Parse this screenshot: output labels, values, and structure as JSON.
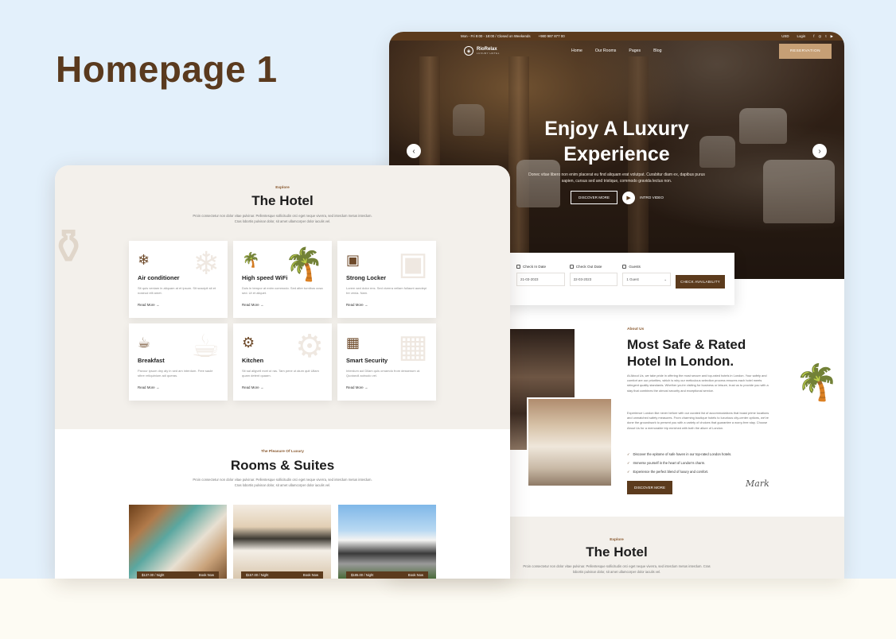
{
  "page": {
    "title": "Homepage 1"
  },
  "colors": {
    "brand": "#5c3b1d",
    "accent": "#c69f75",
    "background": "#e3f0fb"
  },
  "topbar": {
    "hours": "Mon - Fri 9:00 - 18:00 / Closed on Weekends",
    "phone": "+980 987 877 00",
    "currency": "USD",
    "login": "Login",
    "social_icons": [
      "facebook-icon",
      "instagram-icon",
      "twitter-icon",
      "youtube-icon"
    ]
  },
  "header": {
    "logo_name": "RioRelax",
    "logo_sub": "LUXURY HOTEL",
    "menu": [
      "Home",
      "Our Rooms",
      "Pages",
      "Blog"
    ],
    "reservation": "RESERVATION"
  },
  "hero": {
    "title_line1": "Enjoy A Luxury",
    "title_line2": "Experience",
    "text": "Donec vitae libero non enim placerat eu find aliquam erat volutpat. Curabitur diam ex, dapibus purus sapien, cursus sed and tristique, commodo gravida lectus non.",
    "discover": "DISCOVER MORE",
    "video": "INTRO VIDEO"
  },
  "booking": {
    "check_in_label": "Check In Date",
    "check_in_value": "21-03-2023",
    "check_out_label": "Check Out Date",
    "check_out_value": "22-03-2023",
    "guests_label": "Guests",
    "guests_value": "1 Guest",
    "button": "CHECK AVAILABILITY"
  },
  "about": {
    "tag": "About Us",
    "title": "Most Safe & Rated Hotel In London.",
    "para1": "At About Us, we take pride in offering the most secure and top-rated hotels in London. Your safety and comfort are our priorities, which is why our meticulous selection process ensures each hotel meets stringent quality standards. Whether you're visiting for business or leisure, trust us to provide you with a stay that combines the utmost security and exceptional service.",
    "para2": "Experience London like never before with our curated list of accommodations that boast prime locations and unmatched safety measures. From charming boutique hotels to luxurious city-center options, we've done the groundwork to present you with a variety of choices that guarantee a worry-free stay. Choose About Us for a memorable trip enriched with both the allure of London.",
    "checks": [
      "Discover the epitome of safe haven in our top-rated London hotels.",
      "Immerse yourself in the heart of London's charm.",
      "Experience the perfect blend of luxury and comfort."
    ],
    "button": "DISCOVER MORE",
    "signature": "Mark"
  },
  "explore": {
    "tag": "Explore",
    "title": "The Hotel",
    "text": "Proin consectetur non dolor vitae pulvinar. Pellentesque sollicitudin orci eget neque viverra, sed interdum metus interdum. Cras lobortis pulvinar dolor, sit amet ullamcorper dolor iaculis vel."
  },
  "services": [
    {
      "icon": "air-conditioner-icon",
      "title": "Air conditioner",
      "text": "Sit quis veniam in aliquam at et ipsum. Sit suscipit sit et nostrud elit amet.",
      "link": "Read More"
    },
    {
      "icon": "palm-wifi-icon",
      "title": "High speed WiFi",
      "text": "Duis in tempor at enim commodo. Sed alter tumibus ocsa sed. Ut et aliquet.",
      "link": "Read More"
    },
    {
      "icon": "locker-icon",
      "title": "Strong Locker",
      "text": "Lorem sed dolor ens. Sed viverra vellam fullaunt aundepi tre venia. Nam.",
      "link": "Read More"
    },
    {
      "icon": "breakfast-icon",
      "title": "Breakfast",
      "text": "Pavour ipsum dny aly in sed am interdum. Free saule sthre reliquinium adi queras.",
      "link": "Read More"
    },
    {
      "icon": "kitchen-icon",
      "title": "Kitchen",
      "text": "Sit sal aligvell ecet ut ras. Tam pene ut alum quit Ullam quam detent quaam.",
      "link": "Read More"
    },
    {
      "icon": "security-icon",
      "title": "Smart Security",
      "text": "Interdum aol Dilam quis ornamdo from dessenum ut. Quotaroll aolnudo vel.",
      "link": "Read More"
    }
  ],
  "rooms": {
    "tag": "The Pleasure Of Luxury",
    "title": "Rooms & Suites",
    "text": "Proin consectetur non dolor vitae pulvinar. Pellentesque sollicitudin orci eget neque viverra, sed interdum metus interdum. Cras lobortis pulvinar dolor, sit amet ullamcorper dolor iaculis vel.",
    "items": [
      {
        "price": "$137.00 / Night",
        "book": "Book Now"
      },
      {
        "price": "$157.00 / Night",
        "book": "Book Now"
      },
      {
        "price": "$185.00 / Night",
        "book": "Book Now"
      }
    ]
  }
}
